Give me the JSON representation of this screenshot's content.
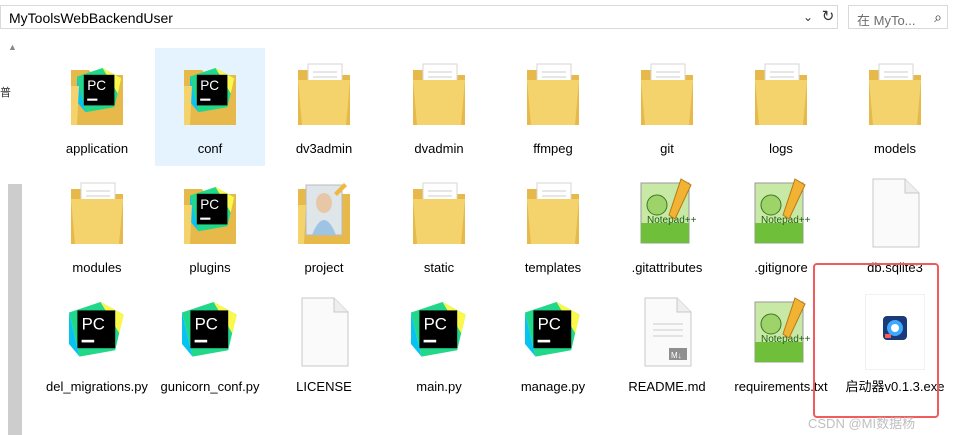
{
  "address": {
    "path": "MyToolsWebBackendUser"
  },
  "search": {
    "placeholder": "在 MyTo..."
  },
  "left_char": "普",
  "files": [
    {
      "name": "application",
      "icon": "folder-pycharm-icon"
    },
    {
      "name": "conf",
      "icon": "folder-pycharm-icon",
      "selected": true
    },
    {
      "name": "dv3admin",
      "icon": "folder-icon"
    },
    {
      "name": "dvadmin",
      "icon": "folder-icon"
    },
    {
      "name": "ffmpeg",
      "icon": "folder-icon"
    },
    {
      "name": "git",
      "icon": "folder-icon"
    },
    {
      "name": "logs",
      "icon": "folder-icon"
    },
    {
      "name": "models",
      "icon": "folder-icon"
    },
    {
      "name": "modules",
      "icon": "folder-icon"
    },
    {
      "name": "plugins",
      "icon": "folder-pycharm-icon"
    },
    {
      "name": "project",
      "icon": "folder-image-icon"
    },
    {
      "name": "static",
      "icon": "folder-icon"
    },
    {
      "name": "templates",
      "icon": "folder-icon"
    },
    {
      "name": ".gitattributes",
      "icon": "notepadpp-icon"
    },
    {
      "name": ".gitignore",
      "icon": "notepadpp-icon"
    },
    {
      "name": "db.sqlite3",
      "icon": "blank-file-icon"
    },
    {
      "name": "del_migrations.py",
      "icon": "pycharm-icon"
    },
    {
      "name": "gunicorn_conf.py",
      "icon": "pycharm-icon"
    },
    {
      "name": "LICENSE",
      "icon": "blank-file-icon"
    },
    {
      "name": "main.py",
      "icon": "pycharm-icon"
    },
    {
      "name": "manage.py",
      "icon": "pycharm-icon"
    },
    {
      "name": "README.md",
      "icon": "markdown-icon"
    },
    {
      "name": "requirements.txt",
      "icon": "notepadpp-icon"
    },
    {
      "name": "启动器v0.1.3.exe",
      "icon": "launcher-exe-icon"
    }
  ],
  "colors": {
    "folder": "#f4d36c",
    "folder_dark": "#e6b94a",
    "pycharm_green": "#21d789",
    "pycharm_yellow": "#fcf84a",
    "pycharm_blue": "#07c3f2",
    "selection": "#e5f3ff",
    "highlight_border": "#f25b5b"
  },
  "watermark": "CSDN @MI数据杨"
}
